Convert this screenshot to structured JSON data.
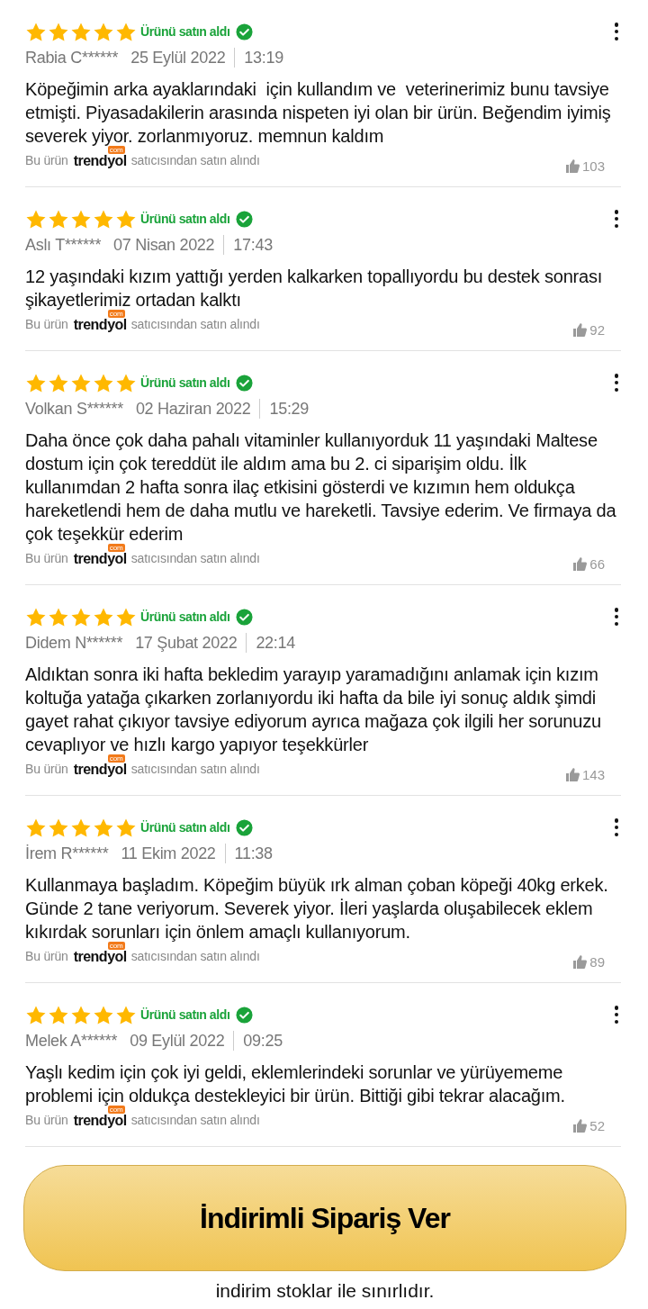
{
  "reviews": [
    {
      "stars": 5,
      "purchase_label": "Ürünü satın aldı",
      "verified": true,
      "author": "Rabia C******",
      "date": "25 Eylül 2022",
      "time": "13:19",
      "text": "Köpeğimin arka ayaklarındaki  için kullandım ve  veterinerimiz bunu tavsiye etmişti. Piyasadakilerin arasında nispeten iyi olan bir ürün. Beğendim iyimiş severek yiyor. zorlanmıyoruz. memnun kaldım",
      "seller_prefix": "Bu ürün",
      "seller_logo": "trendyol",
      "seller_logo_badge": "com",
      "seller_suffix": "satıcısından satın alındı",
      "likes": "103"
    },
    {
      "stars": 5,
      "purchase_label": "Ürünü satın aldı",
      "verified": true,
      "author": "Aslı T******",
      "date": "07 Nisan 2022",
      "time": "17:43",
      "text": "12 yaşındaki kızım yattığı yerden kalkarken topallıyordu bu destek sonrası şikayetlerimiz ortadan kalktı",
      "seller_prefix": "Bu ürün",
      "seller_logo": "trendyol",
      "seller_logo_badge": "com",
      "seller_suffix": "satıcısından satın alındı",
      "likes": "92"
    },
    {
      "stars": 5,
      "purchase_label": "Ürünü satın aldı",
      "verified": true,
      "author": "Volkan S******",
      "date": "02 Haziran 2022",
      "time": "15:29",
      "text": "Daha önce çok daha pahalı vitaminler kullanıyorduk 11 yaşındaki Maltese dostum için çok tereddüt ile aldım ama bu 2. ci siparişim oldu. İlk kullanımdan 2 hafta sonra ilaç etkisini gösterdi ve kızımın hem oldukça hareketlendi hem de daha mutlu ve hareketli. Tavsiye ederim. Ve firmaya da çok teşekkür ederim",
      "seller_prefix": "Bu ürün",
      "seller_logo": "trendyol",
      "seller_logo_badge": "com",
      "seller_suffix": "satıcısından satın alındı",
      "likes": "66"
    },
    {
      "stars": 5,
      "purchase_label": "Ürünü satın aldı",
      "verified": true,
      "author": "Didem N******",
      "date": "17 Şubat 2022",
      "time": "22:14",
      "text": "Aldıktan sonra iki hafta bekledim yarayıp yaramadığını anlamak için kızım koltuğa yatağa çıkarken zorlanıyordu iki hafta da bile iyi sonuç aldık şimdi gayet rahat çıkıyor tavsiye ediyorum ayrıca mağaza çok ilgili her sorunuzu cevaplıyor ve hızlı kargo yapıyor teşekkürler",
      "seller_prefix": "Bu ürün",
      "seller_logo": "trendyol",
      "seller_logo_badge": "com",
      "seller_suffix": "satıcısından satın alındı",
      "likes": "143"
    },
    {
      "stars": 5,
      "purchase_label": "Ürünü satın aldı",
      "verified": true,
      "author": "İrem R******",
      "date": "11 Ekim 2022",
      "time": "11:38",
      "text": "Kullanmaya başladım. Köpeğim büyük ırk alman çoban köpeği 40kg erkek. Günde 2 tane veriyorum. Severek yiyor. İleri yaşlarda oluşabilecek eklem kıkırdak sorunları için önlem amaçlı kullanıyorum.",
      "seller_prefix": "Bu ürün",
      "seller_logo": "trendyol",
      "seller_logo_badge": "com",
      "seller_suffix": "satıcısından satın alındı",
      "likes": "89"
    },
    {
      "stars": 5,
      "purchase_label": "Ürünü satın aldı",
      "verified": true,
      "author": "Melek A******",
      "date": "09 Eylül 2022",
      "time": "09:25",
      "text": "Yaşlı kedim için çok iyi geldi, eklemlerindeki sorunlar ve yürüyememe problemi için oldukça destekleyici bir ürün. Bittiği gibi tekrar alacağım.",
      "seller_prefix": "Bu ürün",
      "seller_logo": "trendyol",
      "seller_logo_badge": "com",
      "seller_suffix": "satıcısından satın alındı",
      "likes": "52"
    }
  ],
  "order_button": "İndirimli Sipariş Ver",
  "stock_note": "indirim stoklar ile sınırlıdır."
}
